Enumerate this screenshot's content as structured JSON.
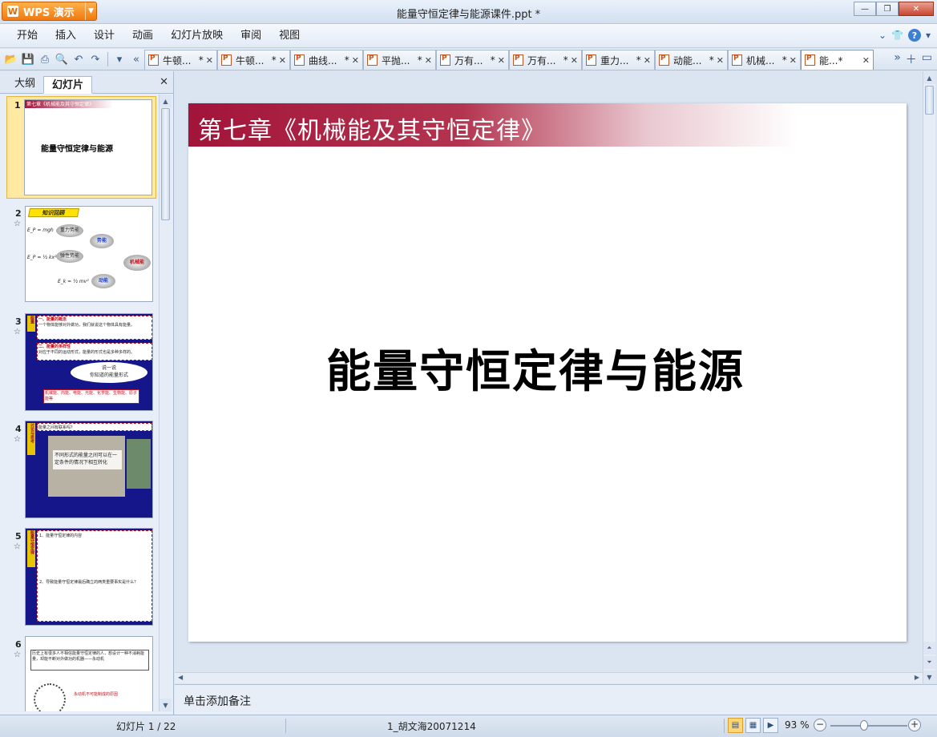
{
  "app": {
    "name": "WPS 演示",
    "document_title": "能量守恒定律与能源课件.ppt *"
  },
  "menu": [
    "开始",
    "插入",
    "设计",
    "动画",
    "幻灯片放映",
    "审阅",
    "视图"
  ],
  "tabs": [
    {
      "label": "牛顿...",
      "mod": "*"
    },
    {
      "label": "牛顿...",
      "mod": "*"
    },
    {
      "label": "曲线...",
      "mod": "*"
    },
    {
      "label": "平抛...",
      "mod": "*"
    },
    {
      "label": "万有...",
      "mod": "*"
    },
    {
      "label": "万有...",
      "mod": "*"
    },
    {
      "label": "重力...",
      "mod": "*"
    },
    {
      "label": "动能...",
      "mod": "*"
    },
    {
      "label": "机械...",
      "mod": "*"
    },
    {
      "label": "能...*",
      "mod": ""
    }
  ],
  "panel": {
    "tab_outline": "大纲",
    "tab_slides": "幻灯片"
  },
  "thumbs": [
    {
      "n": "1",
      "star": "",
      "header": "第七章《机械能及其守恒定律》",
      "text": "能量守恒定律与能源"
    },
    {
      "n": "2",
      "star": "☆",
      "header": "知识回顾",
      "labels": [
        "重力势能",
        "弹性势能",
        "动能",
        "势能",
        "机械能"
      ],
      "formulas": [
        "E_P = mgh",
        "E_P = ½ kx²",
        "E_k = ½ mv²"
      ]
    },
    {
      "n": "3",
      "star": "☆",
      "side": "能量",
      "lines": [
        "一、能量的概念",
        "一个物体能够对外做功，我们就说这个物体具有能量。",
        "二、能量的多样性",
        "对应于不同的运动形式，能量的形式也是多种多样的。",
        "说一说",
        "你知道的能量形式",
        "机械能、内能、电能、光能、化学能、生物能、原子能等"
      ]
    },
    {
      "n": "4",
      "star": "☆",
      "side": "讨论与思考",
      "lines": [
        "能量之间有联系吗？",
        "不同形式的能量之间可以在一定条件的情况下相互转化"
      ]
    },
    {
      "n": "5",
      "star": "☆",
      "side": "能量守恒定律",
      "lines": [
        "1、能量守恒定律的内容",
        "2、导致能量守恒定律最后确立的两类重要事实是什么？"
      ]
    },
    {
      "n": "6",
      "star": "☆",
      "lines": [
        "历史上有很多人不相信能量守恒定律的人，想设计一种不消耗能量，却能不断对外做功的机器——永动机",
        "永动机不可能制成的原因"
      ]
    }
  ],
  "slide": {
    "banner": "第七章《机械能及其守恒定律》",
    "title": "能量守恒定律与能源"
  },
  "notes_placeholder": "单击添加备注",
  "status": {
    "slide_indicator": "幻灯片 1 / 22",
    "template": "1_胡文海20071214",
    "zoom": "93 %"
  },
  "colors": {
    "accent": "#a2143a",
    "app_orange": "#f07a10"
  }
}
